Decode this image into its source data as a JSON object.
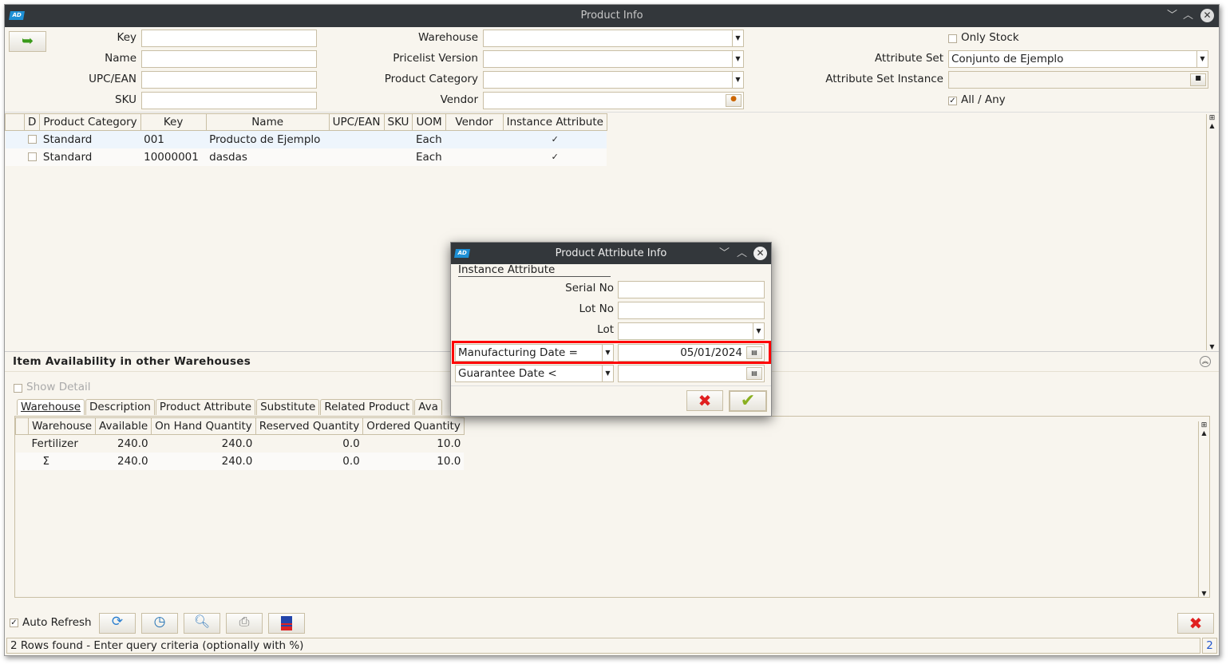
{
  "window": {
    "title": "Product Info"
  },
  "search": {
    "key_label": "Key",
    "name_label": "Name",
    "upc_label": "UPC/EAN",
    "sku_label": "SKU",
    "warehouse_label": "Warehouse",
    "pricelist_label": "Pricelist Version",
    "category_label": "Product Category",
    "vendor_label": "Vendor",
    "only_stock_label": "Only Stock",
    "attribute_set_label": "Attribute Set",
    "attribute_set_value": "Conjunto de Ejemplo",
    "attribute_set_instance_label": "Attribute Set Instance",
    "all_any_label": "All / Any"
  },
  "grid": {
    "columns": [
      "D",
      "Product Category",
      "Key",
      "Name",
      "UPC/EAN",
      "SKU",
      "UOM",
      "Vendor",
      "Instance Attribute"
    ],
    "rows": [
      {
        "category": "Standard",
        "key": "001",
        "name": "Producto de Ejemplo",
        "uom": "Each",
        "instance": "✓"
      },
      {
        "category": "Standard",
        "key": "10000001",
        "name": "dasdas",
        "uom": "Each",
        "instance": "✓"
      }
    ]
  },
  "availability": {
    "title": "Item Availability in other Warehouses",
    "show_detail": "Show Detail",
    "tabs": [
      "Warehouse",
      "Description",
      "Product Attribute",
      "Substitute",
      "Related Product",
      "Ava"
    ],
    "columns": [
      "Warehouse",
      "Available",
      "On Hand Quantity",
      "Reserved Quantity",
      "Ordered Quantity"
    ],
    "rows": [
      [
        "Fertilizer",
        "240.0",
        "240.0",
        "0.0",
        "10.0"
      ],
      [
        "Σ",
        "240.0",
        "240.0",
        "0.0",
        "10.0"
      ]
    ]
  },
  "footer": {
    "auto_refresh": "Auto Refresh",
    "status": "2 Rows found - Enter query criteria (optionally with %)",
    "count": "2"
  },
  "dialog": {
    "title": "Product Attribute Info",
    "section": "Instance Attribute",
    "serial_label": "Serial No",
    "lotno_label": "Lot No",
    "lot_label": "Lot",
    "mfg_operator": "Manufacturing Date =",
    "mfg_value": "05/01/2024",
    "guarantee_operator": "Guarantee Date <"
  },
  "colors": {
    "titlebar": "#33373b",
    "highlight": "#ff0000",
    "background": "#f8f5ee"
  }
}
